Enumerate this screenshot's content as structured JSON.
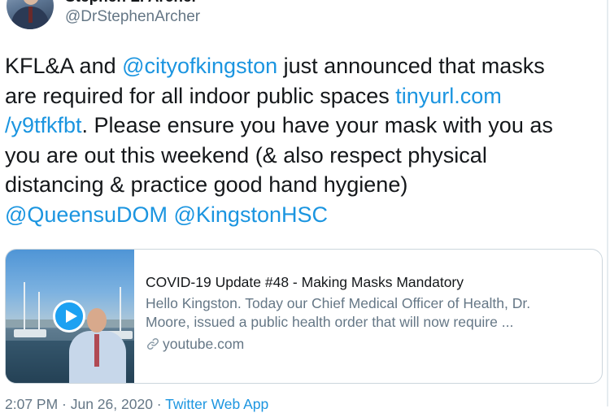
{
  "author": {
    "display_name": "Stephen L. Archer",
    "handle": "@DrStephenArcher"
  },
  "tweet": {
    "lines": [
      [
        {
          "t": "KFL&A and "
        },
        {
          "t": "@cityofkingston",
          "link": true
        },
        {
          "t": " just announced that masks"
        }
      ],
      [
        {
          "t": "are required for all indoor public spaces "
        },
        {
          "t": "tinyurl.com",
          "link": true
        }
      ],
      [
        {
          "t": "/y9tfkfbt",
          "link": true
        },
        {
          "t": ". Please ensure you have your mask with you as"
        }
      ],
      [
        {
          "t": "you are out this weekend (& also respect physical"
        }
      ],
      [
        {
          "t": "distancing & practice good hand hygiene)"
        }
      ],
      [
        {
          "t": "@QueensuDOM",
          "link": true
        },
        {
          "t": " "
        },
        {
          "t": "@KingstonHSC",
          "link": true
        }
      ]
    ]
  },
  "card": {
    "title": "COVID-19 Update #48 - Making Masks Mandatory",
    "description_line1": "Hello Kingston. Today our Chief Medical Officer of Health, Dr.",
    "description_line2": "Moore, issued a public health order that will now require ...",
    "domain": "youtube.com",
    "link_icon": "link-icon",
    "play_icon": "play-icon"
  },
  "meta": {
    "time": "2:07 PM · Jun 26, 2020",
    "separator": " · ",
    "source": "Twitter Web App"
  },
  "colors": {
    "link": "#1b95e0",
    "secondary_text": "#657786",
    "border": "#ccd6dd",
    "play_button": "#1da1f2"
  }
}
